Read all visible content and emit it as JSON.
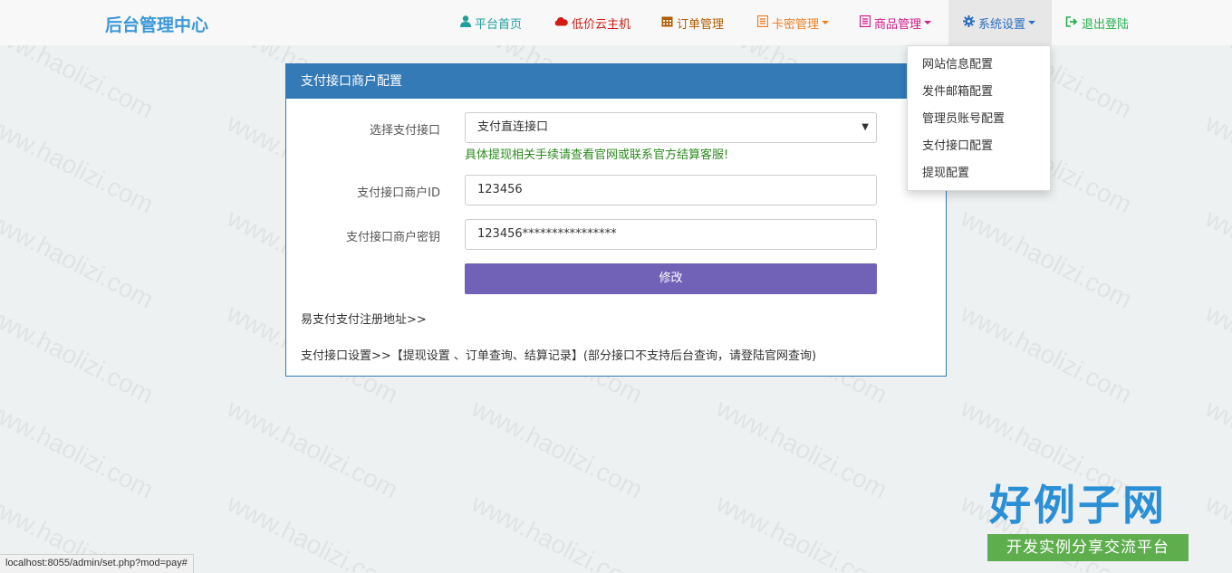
{
  "navbar": {
    "brand": "后台管理中心",
    "items": [
      {
        "label": "平台首页",
        "icon": "user-icon",
        "color": "#1f9f9b",
        "dropdown": false
      },
      {
        "label": "低价云主机",
        "icon": "cloud-icon",
        "color": "#d11a12",
        "dropdown": false
      },
      {
        "label": "订单管理",
        "icon": "calendar-icon",
        "color": "#b05b00",
        "dropdown": false
      },
      {
        "label": "卡密管理",
        "icon": "list-icon",
        "color": "#f07e21",
        "dropdown": true
      },
      {
        "label": "商品管理",
        "icon": "list-icon",
        "color": "#d41b8a",
        "dropdown": true
      },
      {
        "label": "系统设置",
        "icon": "gear-icon",
        "color": "#2a6fc2",
        "dropdown": true,
        "active": true
      },
      {
        "label": "退出登陆",
        "icon": "logout-icon",
        "color": "#23b14d",
        "dropdown": false
      }
    ]
  },
  "dropdown": {
    "items": [
      "网站信息配置",
      "发件邮箱配置",
      "管理员账号配置",
      "支付接口配置",
      "提现配置"
    ]
  },
  "panel": {
    "title": "支付接口商户配置",
    "select_label": "选择支付接口",
    "select_value": "支付直连接口",
    "help_text": "具体提现相关手续请查看官网或联系官方结算客服!",
    "merchant_id_label": "支付接口商户ID",
    "merchant_id_value": "123456",
    "merchant_key_label": "支付接口商户密钥",
    "merchant_key_value": "123456****************",
    "submit_label": "修改",
    "register_link": "易支付支付注册地址>>",
    "settings_note": "支付接口设置>>【提现设置 、订单查询、结算记录】(部分接口不支持后台查询，请登陆官网查询)"
  },
  "watermark": {
    "text": "www.haolizi.com",
    "logo_title": "好例子网",
    "logo_subtitle": "开发实例分享交流平台"
  },
  "statusbar": {
    "url": "localhost:8055/admin/set.php?mod=pay#"
  },
  "colors": {
    "primary": "#337ab7",
    "submit": "#7262b7",
    "help": "#2c8a1f"
  }
}
